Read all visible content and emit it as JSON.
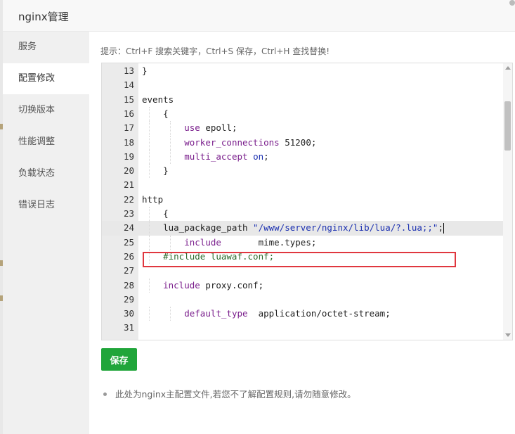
{
  "window": {
    "title": "nginx管理"
  },
  "sidebar": {
    "items": [
      {
        "label": "服务",
        "active": false
      },
      {
        "label": "配置修改",
        "active": true
      },
      {
        "label": "切换版本",
        "active": false
      },
      {
        "label": "性能调整",
        "active": false
      },
      {
        "label": "负载状态",
        "active": false
      },
      {
        "label": "错误日志",
        "active": false
      }
    ]
  },
  "content": {
    "tip": "提示：Ctrl+F 搜索关键字，Ctrl+S 保存，Ctrl+H 查找替换!",
    "editor": {
      "lines": [
        {
          "n": "13",
          "text": "}"
        },
        {
          "n": "14",
          "text": ""
        },
        {
          "n": "15",
          "text": "events"
        },
        {
          "n": "16",
          "text": "    {"
        },
        {
          "n": "17",
          "text": "        use epoll;"
        },
        {
          "n": "18",
          "text": "        worker_connections 51200;"
        },
        {
          "n": "19",
          "text": "        multi_accept on;"
        },
        {
          "n": "20",
          "text": "    }"
        },
        {
          "n": "21",
          "text": ""
        },
        {
          "n": "22",
          "text": "http"
        },
        {
          "n": "23",
          "text": "    {"
        },
        {
          "n": "24",
          "text": "    lua_package_path \"/www/server/nginx/lib/lua/?.lua;;\";"
        },
        {
          "n": "25",
          "text": "        include       mime.types;"
        },
        {
          "n": "26",
          "text": "    #include luawaf.conf;"
        },
        {
          "n": "27",
          "text": ""
        },
        {
          "n": "28",
          "text": "    include proxy.conf;"
        },
        {
          "n": "29",
          "text": ""
        },
        {
          "n": "30",
          "text": "        default_type  application/octet-stream;"
        },
        {
          "n": "31",
          "text": ""
        }
      ],
      "active_line": "24"
    },
    "save_label": "保存",
    "note": "此处为nginx主配置文件,若您不了解配置规则,请勿随意修改。"
  },
  "colors": {
    "accent": "#20a53a",
    "highlight": "#e0373f",
    "keyword": "#7a1e8c",
    "string": "#1a2fb0"
  }
}
